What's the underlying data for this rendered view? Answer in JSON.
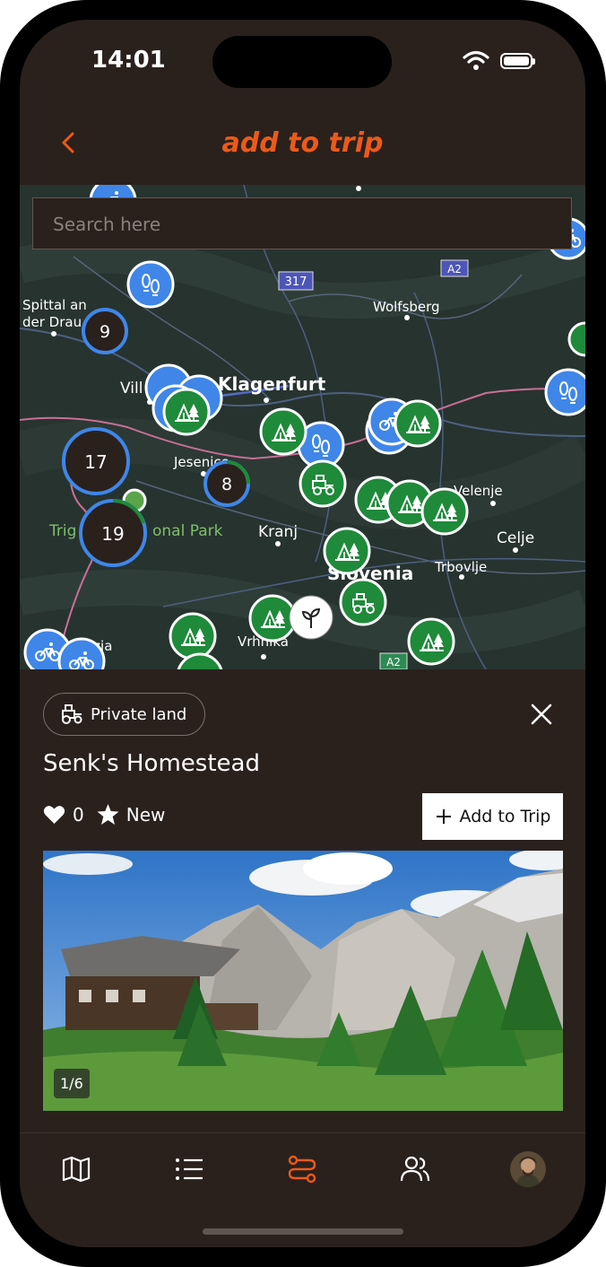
{
  "status": {
    "time": "14:01"
  },
  "header": {
    "title": "add to trip"
  },
  "search": {
    "placeholder": "Search here"
  },
  "map": {
    "labels": {
      "spittal": "Spittal an",
      "spittal2": "der Drau",
      "villach": "Vill",
      "klagenfurt": "Klagenfurt",
      "wolfsberg": "Wolfsberg",
      "jesenice": "Jesenice",
      "triglav_a": "Trig",
      "triglav_b": "onal Park",
      "kranj": "Kranj",
      "velenje": "Velenje",
      "celje": "Celje",
      "slovenia": "Slovenia",
      "trbovlje": "Trbovlje",
      "vrhnika": "Vrhnika",
      "gorizia": "izia",
      "road_317": "317",
      "road_a2": "A2",
      "road_a2b": "A2"
    },
    "clusters": {
      "c9": "9",
      "c17": "17",
      "c8": "8",
      "c19": "19"
    }
  },
  "place": {
    "category": "Private land",
    "name": "Senk's Homestead",
    "likes": "0",
    "rating": "New",
    "add_label": "Add to Trip",
    "photo_counter": "1/6"
  },
  "tabs": [
    "map",
    "list",
    "route",
    "community",
    "profile"
  ],
  "colors": {
    "accent": "#ec5a19",
    "background": "#2a211d",
    "marker_green": "#1f8a3a",
    "marker_blue": "#3f86e8"
  }
}
